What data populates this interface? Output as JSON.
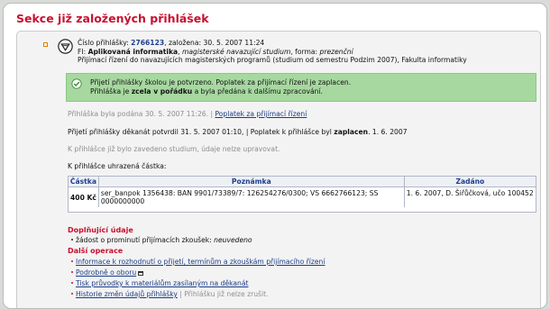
{
  "header": {
    "title": "Sekce již založených přihlášek"
  },
  "application": {
    "number_label": "Číslo přihlášky:",
    "number": "2766123",
    "founded": ", založena: 30. 5. 2007 11:24",
    "faculty_prefix": "FI: ",
    "program": "Aplikovaná informatika",
    "study_type": "magisterské navazující studium",
    "form_label": ", forma: ",
    "form": "prezenční",
    "admission": "Přijímací řízení do navazujících magisterských programů (studium od semestru Podzim 2007), Fakulta informatiky"
  },
  "confirmation": {
    "line1": "Přijetí přihlášky školou je potvrzeno. Poplatek za přijímací řízení je zaplacen.",
    "line2_a": "Přihláška je ",
    "line2_b": "zcela v pořádku",
    "line2_c": " a byla předána k dalšímu zpracování."
  },
  "submitted": {
    "text": "Přihláška byla podána 30. 5. 2007 11:26. | ",
    "link": "Poplatek za přijímací řízení"
  },
  "dean": {
    "text_a": "Přijetí přihlášky děkanát potvrdil 31. 5. 2007 01:10, | Poplatek k přihlášce byl ",
    "text_b": "zaplacen",
    "text_c": ". 1. 6. 2007"
  },
  "study_note": "K přihlášce již bylo zavedeno studium, údaje nelze upravovat.",
  "paid_label": "K přihlášce uhrazená částka:",
  "payments": {
    "headers": [
      "Částka",
      "Poznámka",
      "Zadáno"
    ],
    "rows": [
      {
        "amount": "400 Kč",
        "note": "ser_banpok 1356438: BAN 9901/73389/7: 126254276/0300; VS 6662766123; SS 0000000000",
        "entered": "1. 6. 2007, D. Šiřůčková, učo 100452"
      }
    ]
  },
  "additional": {
    "title": "Doplňující údaje",
    "waiver_label": "žádost o prominutí přijímacích zkoušek: ",
    "waiver_value": "neuvedeno"
  },
  "operations": {
    "title": "Další operace",
    "items": [
      "Informace k rozhodnutí o přijetí, termínům a zkouškám přijímacího řízení",
      "Podrobně o oboru",
      "Tisk průvodky k materiálům zasílaným na děkanát",
      "Historie změn údajů přihlášky"
    ],
    "cannot_cancel": " | Přihlášku již nelze zrušit."
  },
  "colors": {
    "accent_red": "#c8102e",
    "link_blue": "#1b3d86",
    "success_green": "#a7d8a0"
  }
}
